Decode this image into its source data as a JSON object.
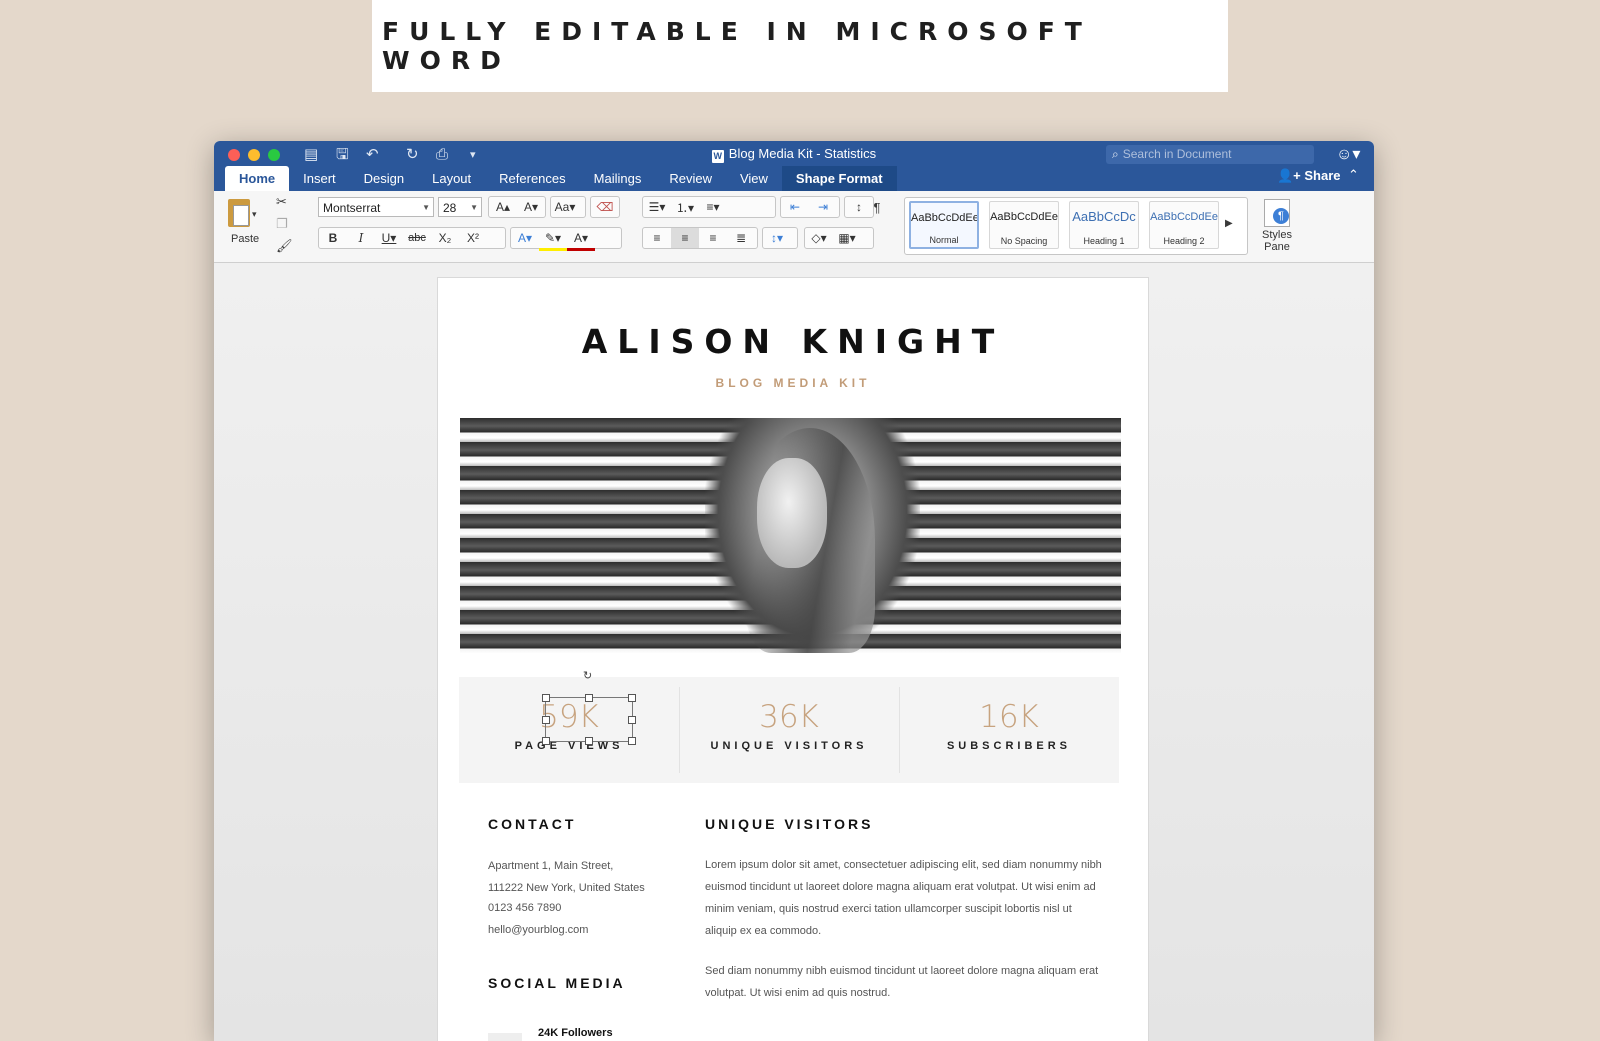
{
  "banner": {
    "text": "FULLY EDITABLE IN MICROSOFT WORD"
  },
  "window": {
    "title": "Blog Media Kit - Statistics",
    "search_placeholder": "Search in Document",
    "tabs": [
      "Home",
      "Insert",
      "Design",
      "Layout",
      "References",
      "Mailings",
      "Review",
      "View",
      "Shape Format"
    ],
    "active_tab": "Home",
    "share_label": "Share"
  },
  "ribbon": {
    "paste_label": "Paste",
    "font_name": "Montserrat",
    "font_size": "28",
    "styles": [
      {
        "sample": "AaBbCcDdEe",
        "name": "Normal",
        "selected": true
      },
      {
        "sample": "AaBbCcDdEe",
        "name": "No Spacing",
        "selected": false
      },
      {
        "sample": "AaBbCcDc",
        "name": "Heading 1",
        "selected": false
      },
      {
        "sample": "AaBbCcDdEe",
        "name": "Heading 2",
        "selected": false
      }
    ],
    "styles_pane_label": "Styles Pane"
  },
  "document": {
    "name": "ALISON KNIGHT",
    "subtitle": "BLOG MEDIA KIT",
    "stats": [
      {
        "value": "59K",
        "label": "PAGE VIEWS"
      },
      {
        "value": "36K",
        "label": "UNIQUE VISITORS"
      },
      {
        "value": "16K",
        "label": "SUBSCRIBERS"
      }
    ],
    "contact": {
      "heading": "CONTACT",
      "lines": [
        "Apartment 1, Main Street,",
        "111222 New York, United States",
        "0123 456 7890",
        "hello@yourblog.com"
      ]
    },
    "social": {
      "heading": "SOCIAL MEDIA",
      "first_item": "24K Followers"
    },
    "unique_visitors": {
      "heading": "UNIQUE VISITORS",
      "paragraphs": [
        "Lorem ipsum dolor sit amet, consectetuer adipiscing elit, sed diam nonummy nibh euismod tincidunt ut laoreet dolore magna aliquam erat volutpat.  Ut wisi enim ad minim veniam, quis nostrud exerci tation ullamcorper suscipit lobortis nisl ut aliquip ex ea commodo.",
        "Sed diam nonummy nibh euismod tincidunt ut laoreet dolore magna aliquam erat volutpat. Ut wisi enim ad quis nostrud."
      ]
    }
  },
  "colors": {
    "background": "#e4d8cb",
    "titlebar": "#2b579a",
    "accent_gold": "#c7a37f"
  }
}
